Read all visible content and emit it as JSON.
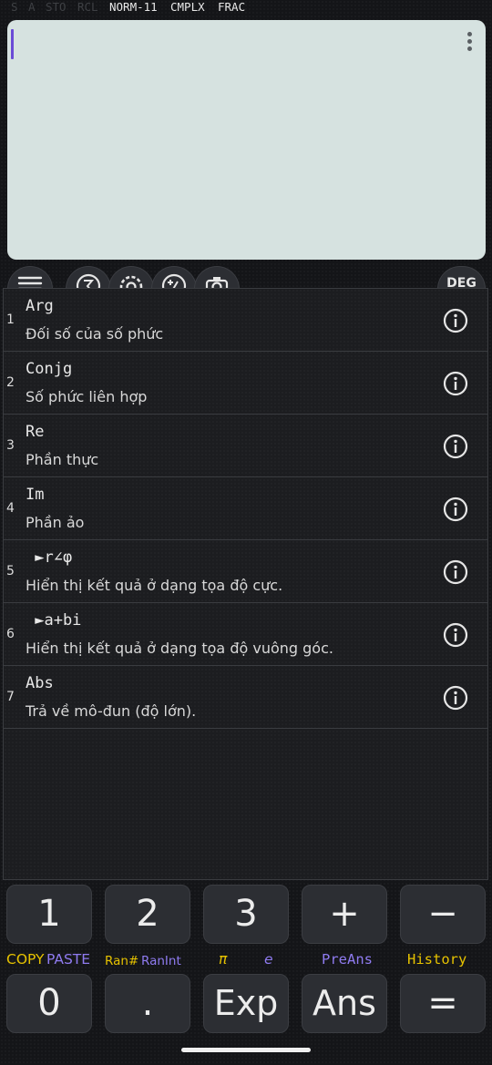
{
  "status": {
    "indicators_dim": [
      "S",
      "A",
      "STO",
      "RCL"
    ],
    "indicators_on": [
      "NORM-11",
      "CMPLX",
      "FRAC"
    ]
  },
  "display": {
    "menu_icon": "kebab-icon"
  },
  "toolbar": {
    "icons": [
      "menu-icon",
      "sigma-icon",
      "gear-icon",
      "plus-minus-icon",
      "camera-icon"
    ],
    "angle_mode": "DEG"
  },
  "functions": [
    {
      "index": "1",
      "name": "Arg",
      "desc": "Đối số của số phức"
    },
    {
      "index": "2",
      "name": "Conjg",
      "desc": "Số phức liên hợp"
    },
    {
      "index": "3",
      "name": "Re",
      "desc": "Phần thực"
    },
    {
      "index": "4",
      "name": "Im",
      "desc": "Phần ảo"
    },
    {
      "index": "5",
      "name": " ►r∠φ",
      "desc": "Hiển thị kết quả ở dạng tọa độ cực."
    },
    {
      "index": "6",
      "name": " ►a+bi",
      "desc": "Hiển thị kết quả ở dạng tọa độ vuông góc."
    },
    {
      "index": "7",
      "name": "Abs",
      "desc": "Trả về mô-đun (độ lớn)."
    }
  ],
  "keypad": {
    "row1": [
      "1",
      "2",
      "3",
      "+",
      "−"
    ],
    "row2": [
      "0",
      ".",
      "Exp",
      "Ans",
      "="
    ],
    "labels": {
      "copy": "COPY",
      "paste": "PASTE",
      "ran": "Ran#",
      "ranint": "RanInt",
      "pi": "π",
      "e": "e",
      "preans": "PreAns",
      "history": "History"
    }
  },
  "colors": {
    "display_bg": "#d6e2e0",
    "cursor": "#6a4bd6",
    "shift": "#e6c200",
    "alpha": "#8f7bf0"
  }
}
